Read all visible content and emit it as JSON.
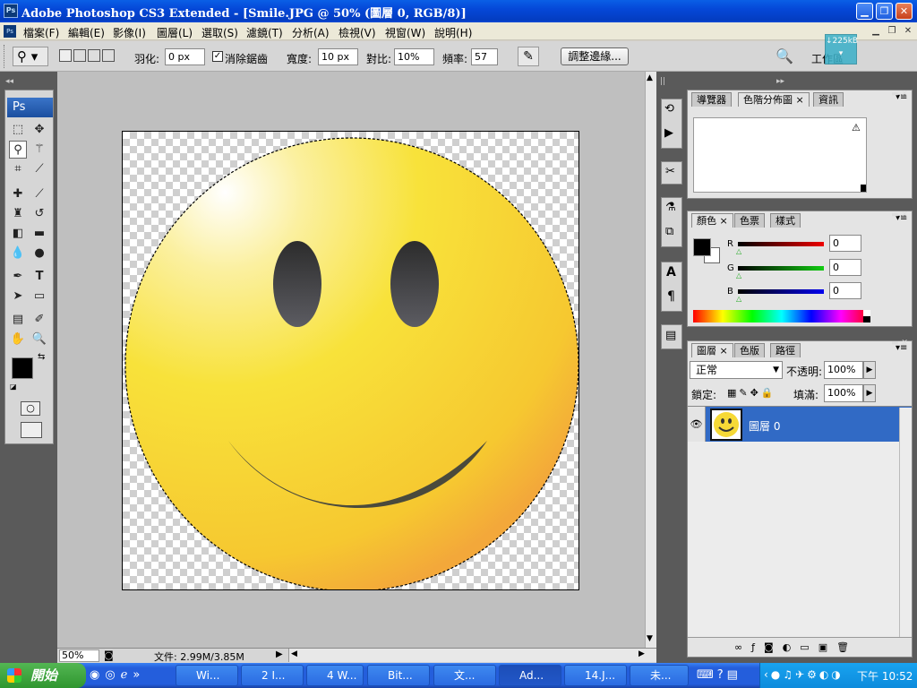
{
  "window": {
    "title": "Adobe Photoshop CS3 Extended - [Smile.JPG @ 50% (圖層 0, RGB/8)]",
    "app_icon": "Ps"
  },
  "menu": [
    "檔案(F)",
    "編輯(E)",
    "影像(I)",
    "圖層(L)",
    "選取(S)",
    "濾鏡(T)",
    "分析(A)",
    "檢視(V)",
    "視窗(W)",
    "說明(H)"
  ],
  "options": {
    "feather_label": "羽化:",
    "feather_value": "0 px",
    "antialias_label": "消除鋸齒",
    "width_label": "寬度:",
    "width_value": "10 px",
    "contrast_label": "對比:",
    "contrast_value": "10%",
    "frequency_label": "頻率:",
    "frequency_value": "57",
    "refine_edge_button": "調整邊緣...",
    "workspace_label": "工作區",
    "network_badge": "↓225kB"
  },
  "toolbox": {
    "logo": "Ps"
  },
  "status": {
    "zoom": "50%",
    "doc_info": "文件: 2.99M/3.85M"
  },
  "panels": {
    "top_tabs": [
      "導覽器",
      "色階分佈圖",
      "資訊"
    ],
    "color_tabs": [
      "顏色",
      "色票",
      "樣式"
    ],
    "color": {
      "r_label": "R",
      "g_label": "G",
      "b_label": "B",
      "r": "0",
      "g": "0",
      "b": "0"
    },
    "layers_tabs": [
      "圖層",
      "色版",
      "路徑"
    ],
    "layers": {
      "blend_mode": "正常",
      "opacity_label": "不透明:",
      "opacity": "100%",
      "lock_label": "鎖定:",
      "fill_label": "填滿:",
      "fill": "100%",
      "layer_name": "圖層 0"
    }
  },
  "taskbar": {
    "start": "開始",
    "tasks": [
      "Wi...",
      "2 I...",
      "4 W...",
      "Bit...",
      "文...",
      "Ad...",
      "14.J...",
      "未..."
    ],
    "clock": "下午 10:52"
  },
  "colors": {
    "accent": "#316ac5",
    "titlebar": "#0548d8",
    "smiley": "#f6d936"
  }
}
